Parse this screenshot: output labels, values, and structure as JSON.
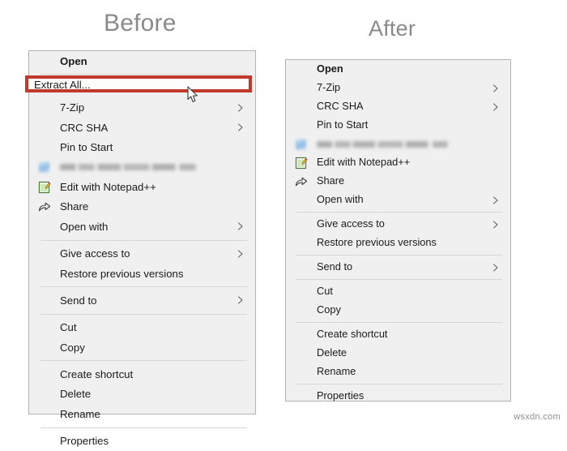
{
  "headings": {
    "before": "Before",
    "after": "After"
  },
  "colors": {
    "highlight": "#c0392b",
    "menu_background": "#f0f0f0",
    "menu_border": "#b4b4b4",
    "menu_text": "#1b1b1b",
    "separator": "#d6d6d6",
    "heading_text": "#8a8a8a",
    "watermark_text": "#8e8e8e"
  },
  "highlight": {
    "label": "Extract All...",
    "target_item": "Extract All..."
  },
  "cursor": {
    "icon": "mouse-pointer-icon"
  },
  "watermark": {
    "text": "wsxdn.com"
  },
  "menu_before": {
    "name": "Before context menu",
    "items": [
      {
        "label": "Open",
        "bold": true,
        "submenu": false,
        "icon": null,
        "type": "item"
      },
      {
        "type": "separator"
      },
      {
        "label": "Extract All...",
        "bold": false,
        "submenu": false,
        "icon": null,
        "type": "item",
        "highlighted": true
      },
      {
        "label": "7-Zip",
        "bold": false,
        "submenu": true,
        "icon": null,
        "type": "item"
      },
      {
        "label": "CRC SHA",
        "bold": false,
        "submenu": true,
        "icon": null,
        "type": "item"
      },
      {
        "label": "Pin to Start",
        "bold": false,
        "submenu": false,
        "icon": null,
        "type": "item"
      },
      {
        "label": "",
        "bold": false,
        "submenu": false,
        "icon": "blurred-app-icon",
        "type": "blurred"
      },
      {
        "label": "Edit with Notepad++",
        "bold": false,
        "submenu": false,
        "icon": "notepad-plus-plus-icon",
        "type": "item"
      },
      {
        "label": "Share",
        "bold": false,
        "submenu": false,
        "icon": "share-icon",
        "type": "item"
      },
      {
        "label": "Open with",
        "bold": false,
        "submenu": true,
        "icon": null,
        "type": "item"
      },
      {
        "type": "separator"
      },
      {
        "label": "Give access to",
        "bold": false,
        "submenu": true,
        "icon": null,
        "type": "item"
      },
      {
        "label": "Restore previous versions",
        "bold": false,
        "submenu": false,
        "icon": null,
        "type": "item"
      },
      {
        "type": "separator"
      },
      {
        "label": "Send to",
        "bold": false,
        "submenu": true,
        "icon": null,
        "type": "item"
      },
      {
        "type": "separator"
      },
      {
        "label": "Cut",
        "bold": false,
        "submenu": false,
        "icon": null,
        "type": "item"
      },
      {
        "label": "Copy",
        "bold": false,
        "submenu": false,
        "icon": null,
        "type": "item"
      },
      {
        "type": "separator"
      },
      {
        "label": "Create shortcut",
        "bold": false,
        "submenu": false,
        "icon": null,
        "type": "item"
      },
      {
        "label": "Delete",
        "bold": false,
        "submenu": false,
        "icon": null,
        "type": "item"
      },
      {
        "label": "Rename",
        "bold": false,
        "submenu": false,
        "icon": null,
        "type": "item"
      },
      {
        "type": "separator"
      },
      {
        "label": "Properties",
        "bold": false,
        "submenu": false,
        "icon": null,
        "type": "item"
      }
    ]
  },
  "menu_after": {
    "name": "After context menu",
    "items": [
      {
        "label": "Open",
        "bold": true,
        "submenu": false,
        "icon": null,
        "type": "item"
      },
      {
        "label": "7-Zip",
        "bold": false,
        "submenu": true,
        "icon": null,
        "type": "item"
      },
      {
        "label": "CRC SHA",
        "bold": false,
        "submenu": true,
        "icon": null,
        "type": "item"
      },
      {
        "label": "Pin to Start",
        "bold": false,
        "submenu": false,
        "icon": null,
        "type": "item"
      },
      {
        "label": "",
        "bold": false,
        "submenu": false,
        "icon": "blurred-app-icon",
        "type": "blurred"
      },
      {
        "label": "Edit with Notepad++",
        "bold": false,
        "submenu": false,
        "icon": "notepad-plus-plus-icon",
        "type": "item"
      },
      {
        "label": "Share",
        "bold": false,
        "submenu": false,
        "icon": "share-icon",
        "type": "item"
      },
      {
        "label": "Open with",
        "bold": false,
        "submenu": true,
        "icon": null,
        "type": "item"
      },
      {
        "type": "separator"
      },
      {
        "label": "Give access to",
        "bold": false,
        "submenu": true,
        "icon": null,
        "type": "item"
      },
      {
        "label": "Restore previous versions",
        "bold": false,
        "submenu": false,
        "icon": null,
        "type": "item"
      },
      {
        "type": "separator"
      },
      {
        "label": "Send to",
        "bold": false,
        "submenu": true,
        "icon": null,
        "type": "item"
      },
      {
        "type": "separator"
      },
      {
        "label": "Cut",
        "bold": false,
        "submenu": false,
        "icon": null,
        "type": "item"
      },
      {
        "label": "Copy",
        "bold": false,
        "submenu": false,
        "icon": null,
        "type": "item"
      },
      {
        "type": "separator"
      },
      {
        "label": "Create shortcut",
        "bold": false,
        "submenu": false,
        "icon": null,
        "type": "item"
      },
      {
        "label": "Delete",
        "bold": false,
        "submenu": false,
        "icon": null,
        "type": "item"
      },
      {
        "label": "Rename",
        "bold": false,
        "submenu": false,
        "icon": null,
        "type": "item"
      },
      {
        "type": "separator"
      },
      {
        "label": "Properties",
        "bold": false,
        "submenu": false,
        "icon": null,
        "type": "item"
      }
    ]
  }
}
